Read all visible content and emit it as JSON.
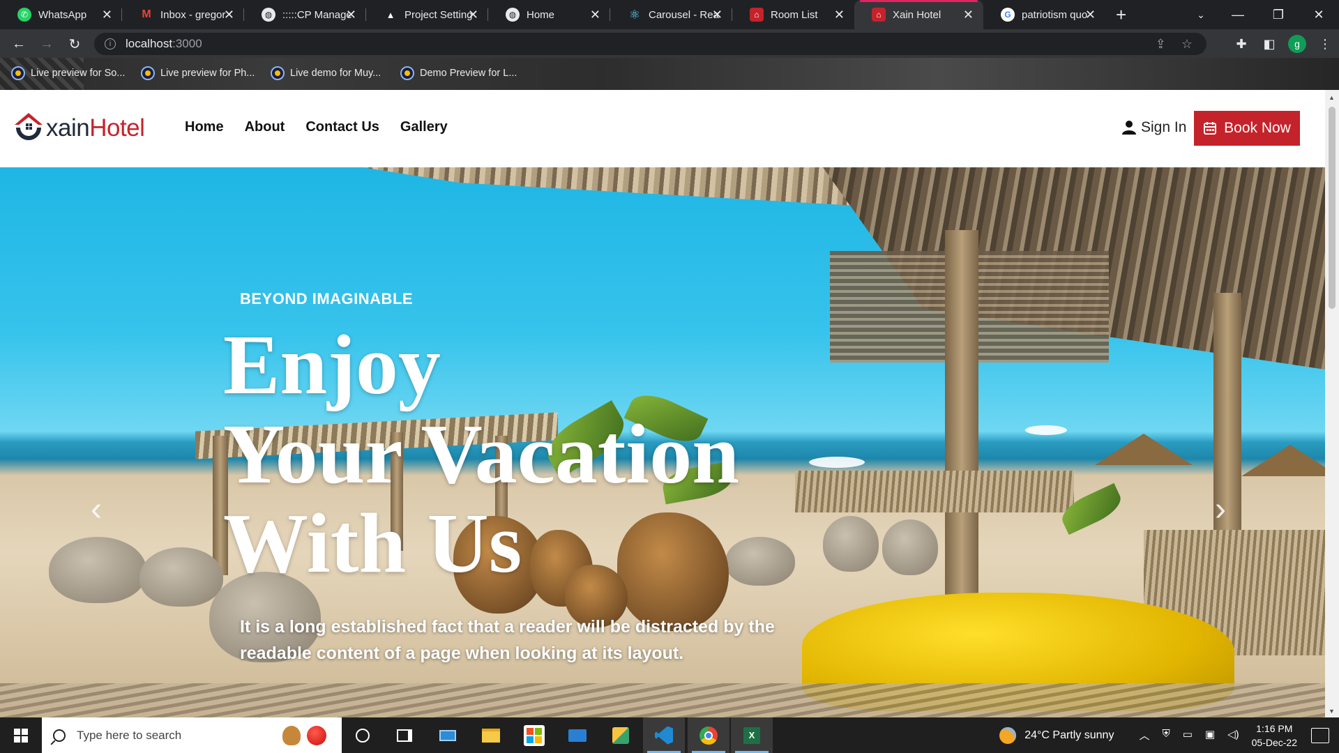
{
  "browser": {
    "tabs": [
      {
        "title": "WhatsApp",
        "icon": "whatsapp-icon",
        "color": "#25d366",
        "glyph": "✆"
      },
      {
        "title": "Inbox - gregor",
        "icon": "gmail-icon",
        "color": "#ea4335",
        "glyph": "M"
      },
      {
        "title": ":::::CP Manage",
        "icon": "globe-icon",
        "color": "#e8eaed",
        "glyph": "◍"
      },
      {
        "title": "Project Setting",
        "icon": "vercel-icon",
        "color": "#202124",
        "glyph": "▲"
      },
      {
        "title": "Home",
        "icon": "globe-icon",
        "color": "#e8eaed",
        "glyph": "◍"
      },
      {
        "title": "Carousel - Rea",
        "icon": "react-icon",
        "color": "#61dafb",
        "glyph": "⚛"
      },
      {
        "title": "Room List",
        "icon": "hotel-icon",
        "color": "#c4232b",
        "glyph": "⌂"
      },
      {
        "title": "Xain Hotel",
        "icon": "hotel-icon",
        "color": "#c4232b",
        "glyph": "⌂",
        "active": true
      },
      {
        "title": "patriotism quo",
        "icon": "google-icon",
        "color": "#ffffff",
        "glyph": "G"
      }
    ],
    "url_host": "localhost",
    "url_port": ":3000",
    "profile_initial": "g",
    "bookmarks": [
      {
        "label": "Live preview for So..."
      },
      {
        "label": "Live preview for Ph..."
      },
      {
        "label": "Live demo for Muy..."
      },
      {
        "label": "Demo Preview for L..."
      }
    ]
  },
  "site": {
    "logo_part1": "xain",
    "logo_part2": "Hotel",
    "nav": [
      "Home",
      "About",
      "Contact Us",
      "Gallery"
    ],
    "sign_in": "Sign In",
    "book_now": "Book Now",
    "brand_color": "#c4232b"
  },
  "hero": {
    "tagline": "BEYOND IMAGINABLE",
    "headline_lines": [
      "Enjoy",
      "Your Vacation",
      "With Us"
    ],
    "subtext": "It is a long established fact that a reader will be distracted by the readable content of a page when looking at its layout."
  },
  "taskbar": {
    "search_placeholder": "Type here to search",
    "weather": "24°C  Partly sunny",
    "time": "1:16 PM",
    "date": "05-Dec-22"
  }
}
